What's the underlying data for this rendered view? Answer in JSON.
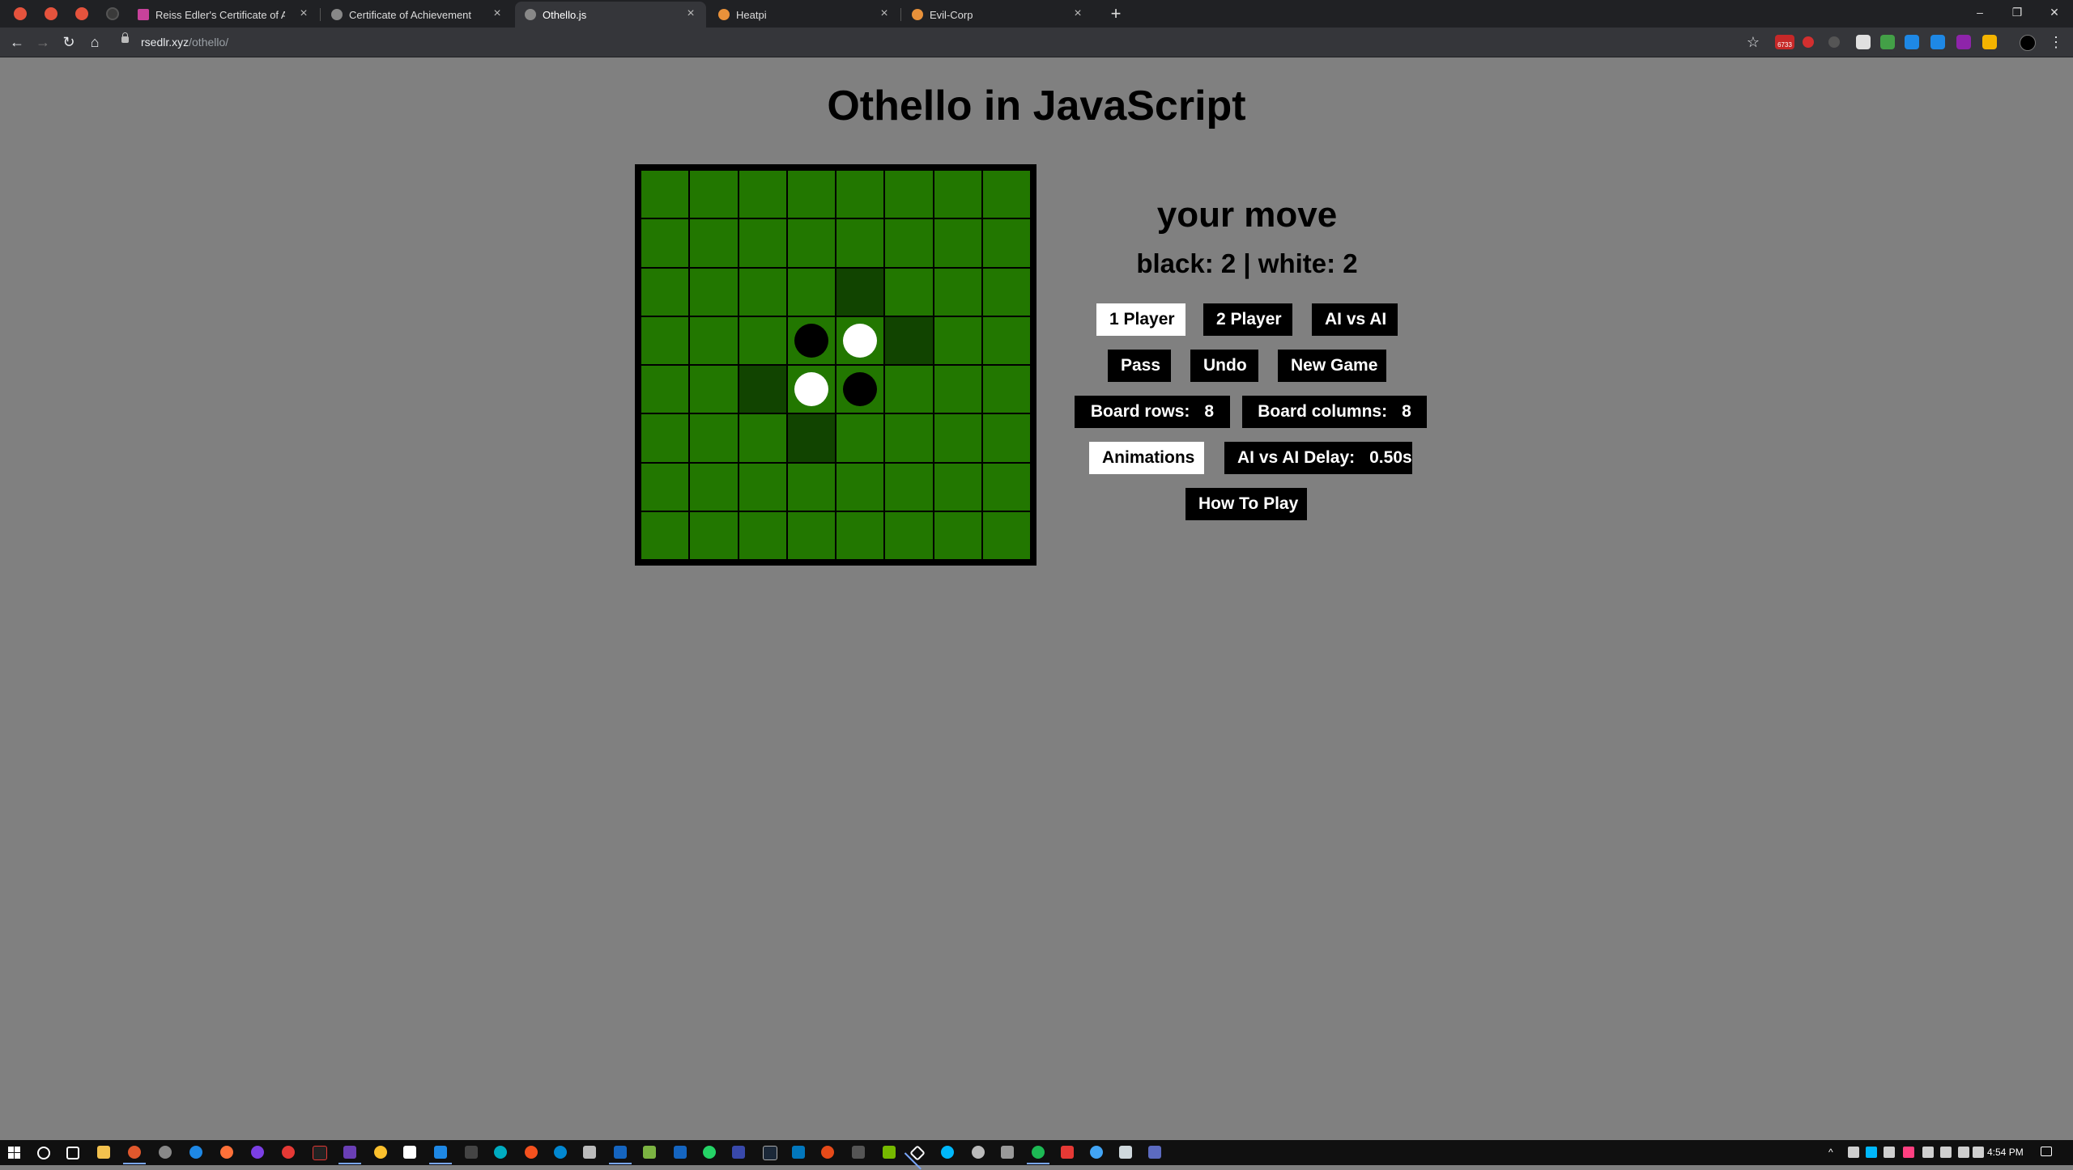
{
  "browser": {
    "tabs": [
      {
        "title": "Reiss Edler's Certificate of Achievement",
        "active": false,
        "favicon_color": "#c8429b"
      },
      {
        "title": "Certificate of Achievement",
        "active": false,
        "favicon_color": "#9aa0a6"
      },
      {
        "title": "Othello.js",
        "active": true,
        "favicon_color": "#9aa0a6"
      },
      {
        "title": "Heatpi",
        "active": false,
        "favicon_color": "#e8913a"
      },
      {
        "title": "Evil-Corp",
        "active": false,
        "favicon_color": "#e8913a"
      }
    ],
    "url_host": "rsedlr.xyz",
    "url_path": "/othello/",
    "window_controls": [
      "–",
      "❐",
      "✕"
    ],
    "new_tab": "+",
    "extension_badge": "6733"
  },
  "page": {
    "title": "Othello in JavaScript",
    "status": "your move",
    "score": "black: 2 | white: 2",
    "buttons": {
      "one_player": "1 Player",
      "two_player": "2 Player",
      "ai_vs_ai": "AI vs AI",
      "pass": "Pass",
      "undo": "Undo",
      "new_game": "New Game",
      "board_rows_label": "Board rows:",
      "board_rows_value": "8",
      "board_cols_label": "Board columns:",
      "board_cols_value": "8",
      "animations": "Animations",
      "ai_delay_label": "AI vs AI Delay:",
      "ai_delay_value": "0.50s",
      "how_to_play": "How To Play"
    },
    "board": {
      "rows": 8,
      "cols": 8,
      "cells": [
        [
          "",
          "",
          "",
          "",
          "",
          "",
          "",
          ""
        ],
        [
          "",
          "",
          "",
          "",
          "",
          "",
          "",
          ""
        ],
        [
          "",
          "",
          "",
          "",
          "hint",
          "",
          "",
          ""
        ],
        [
          "",
          "",
          "",
          "black",
          "white",
          "hint",
          "",
          ""
        ],
        [
          "",
          "",
          "hint",
          "white",
          "black",
          "",
          "",
          ""
        ],
        [
          "",
          "",
          "",
          "hint",
          "",
          "",
          "",
          ""
        ],
        [
          "",
          "",
          "",
          "",
          "",
          "",
          "",
          ""
        ],
        [
          "",
          "",
          "",
          "",
          "",
          "",
          "",
          ""
        ]
      ],
      "colors": {
        "square": "#227700",
        "hint": "#114400",
        "grid": "#000000",
        "black": "#000000",
        "white": "#ffffff"
      }
    }
  },
  "taskbar": {
    "clock": "4:54 PM"
  }
}
